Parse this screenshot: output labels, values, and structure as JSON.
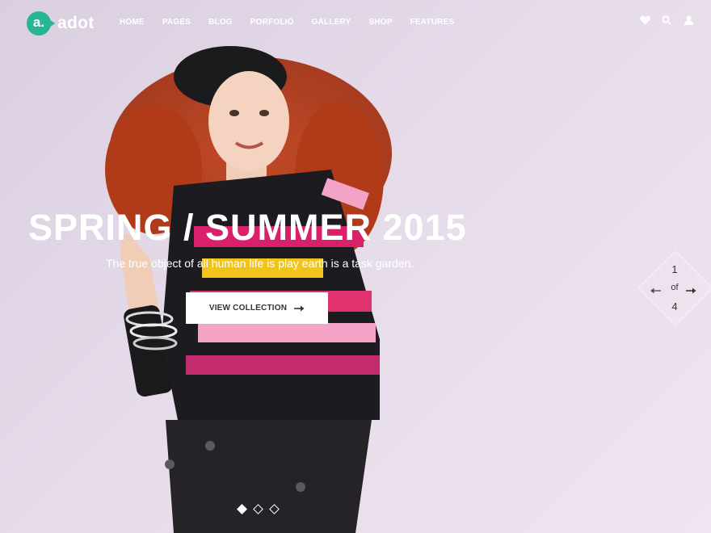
{
  "brand": {
    "logo_mark": "a.",
    "name": "adot",
    "accent": "#27b695"
  },
  "nav": {
    "items": [
      "HOME",
      "PAGES",
      "BLOG",
      "PORFOLIO",
      "GALLERY",
      "SHOP",
      "FEATURES"
    ]
  },
  "header_icons": [
    "heart-icon",
    "search-icon",
    "user-icon"
  ],
  "hero": {
    "title": "SPRING / SUMMER 2015",
    "subtitle": "The true object of all human life is play earth is a task garden.",
    "cta_label": "VIEW COLLECTION"
  },
  "pager": {
    "current": "1",
    "of_label": "of",
    "total": "4"
  },
  "slider_dots": {
    "count": 3,
    "active_index": 0
  }
}
